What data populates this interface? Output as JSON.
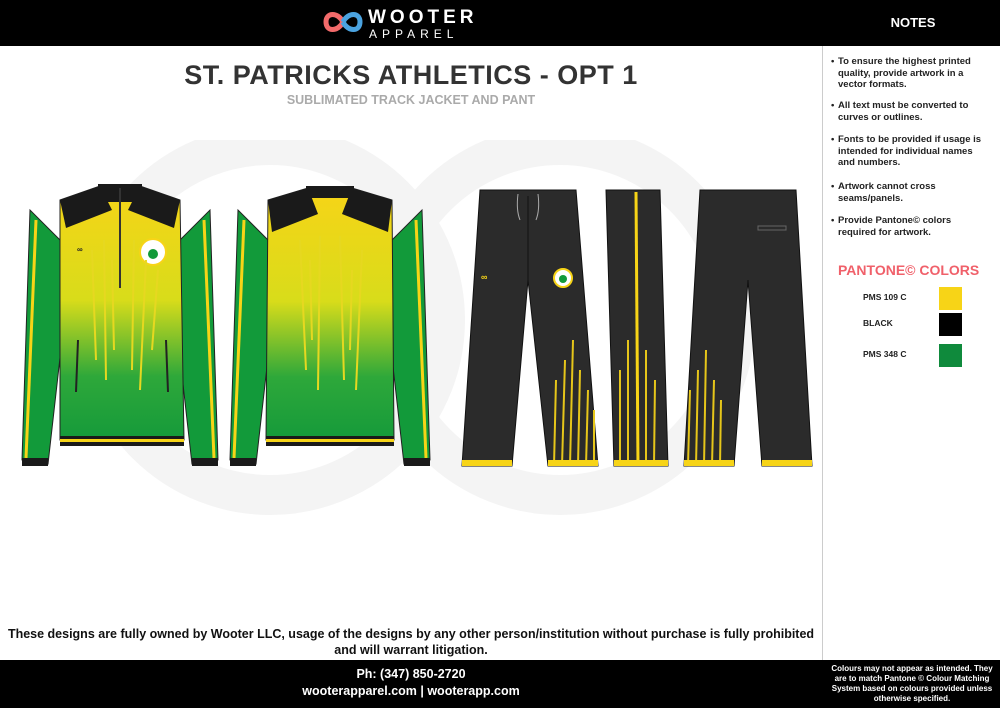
{
  "brand": {
    "name": "WOOTER",
    "sub": "APPAREL"
  },
  "notes_title": "NOTES",
  "title": "ST. PATRICKS ATHLETICS - OPT 1",
  "subtitle": "SUBLIMATED TRACK JACKET AND PANT",
  "notes": [
    {
      "line1": "To ensure the highest printed",
      "line2": "quality, provide artwork in  a",
      "line3": "vector formats."
    },
    {
      "line1": "All text must be converted to",
      "line2": "curves or outlines.",
      "line3": ""
    },
    {
      "line1": "Fonts to be provided if usage is",
      "line2": "intended for individual names",
      "line3": "and numbers."
    },
    {
      "line1": "Artwork cannot cross",
      "line2": "seams/panels.",
      "line3": ""
    },
    {
      "line1": "Provide Pantone© colors",
      "line2": "required for artwork.",
      "line3": ""
    }
  ],
  "pantone_title": "PANTONE©  COLORS",
  "pantone": [
    {
      "label": "PMS 109 C",
      "color": "#f7d417"
    },
    {
      "label": "BLACK",
      "color": "#000000"
    },
    {
      "label": "PMS 348 C",
      "color": "#0f8a3c"
    }
  ],
  "disclaimer": {
    "line1": "These designs are fully owned by Wooter LLC, usage of the designs by any other person/institution without purchase is fully prohibited",
    "line2": "and will warrant litigation."
  },
  "phone": "Ph: (347) 850-2720",
  "website": "wooterapparel.com | wooterapp.com",
  "colour_note": {
    "line1": "Colours may not appear as intended. They",
    "line2": "are to match Pantone © Colour Matching",
    "line3": "System based on colours provided unless",
    "line4": "otherwise specified."
  }
}
